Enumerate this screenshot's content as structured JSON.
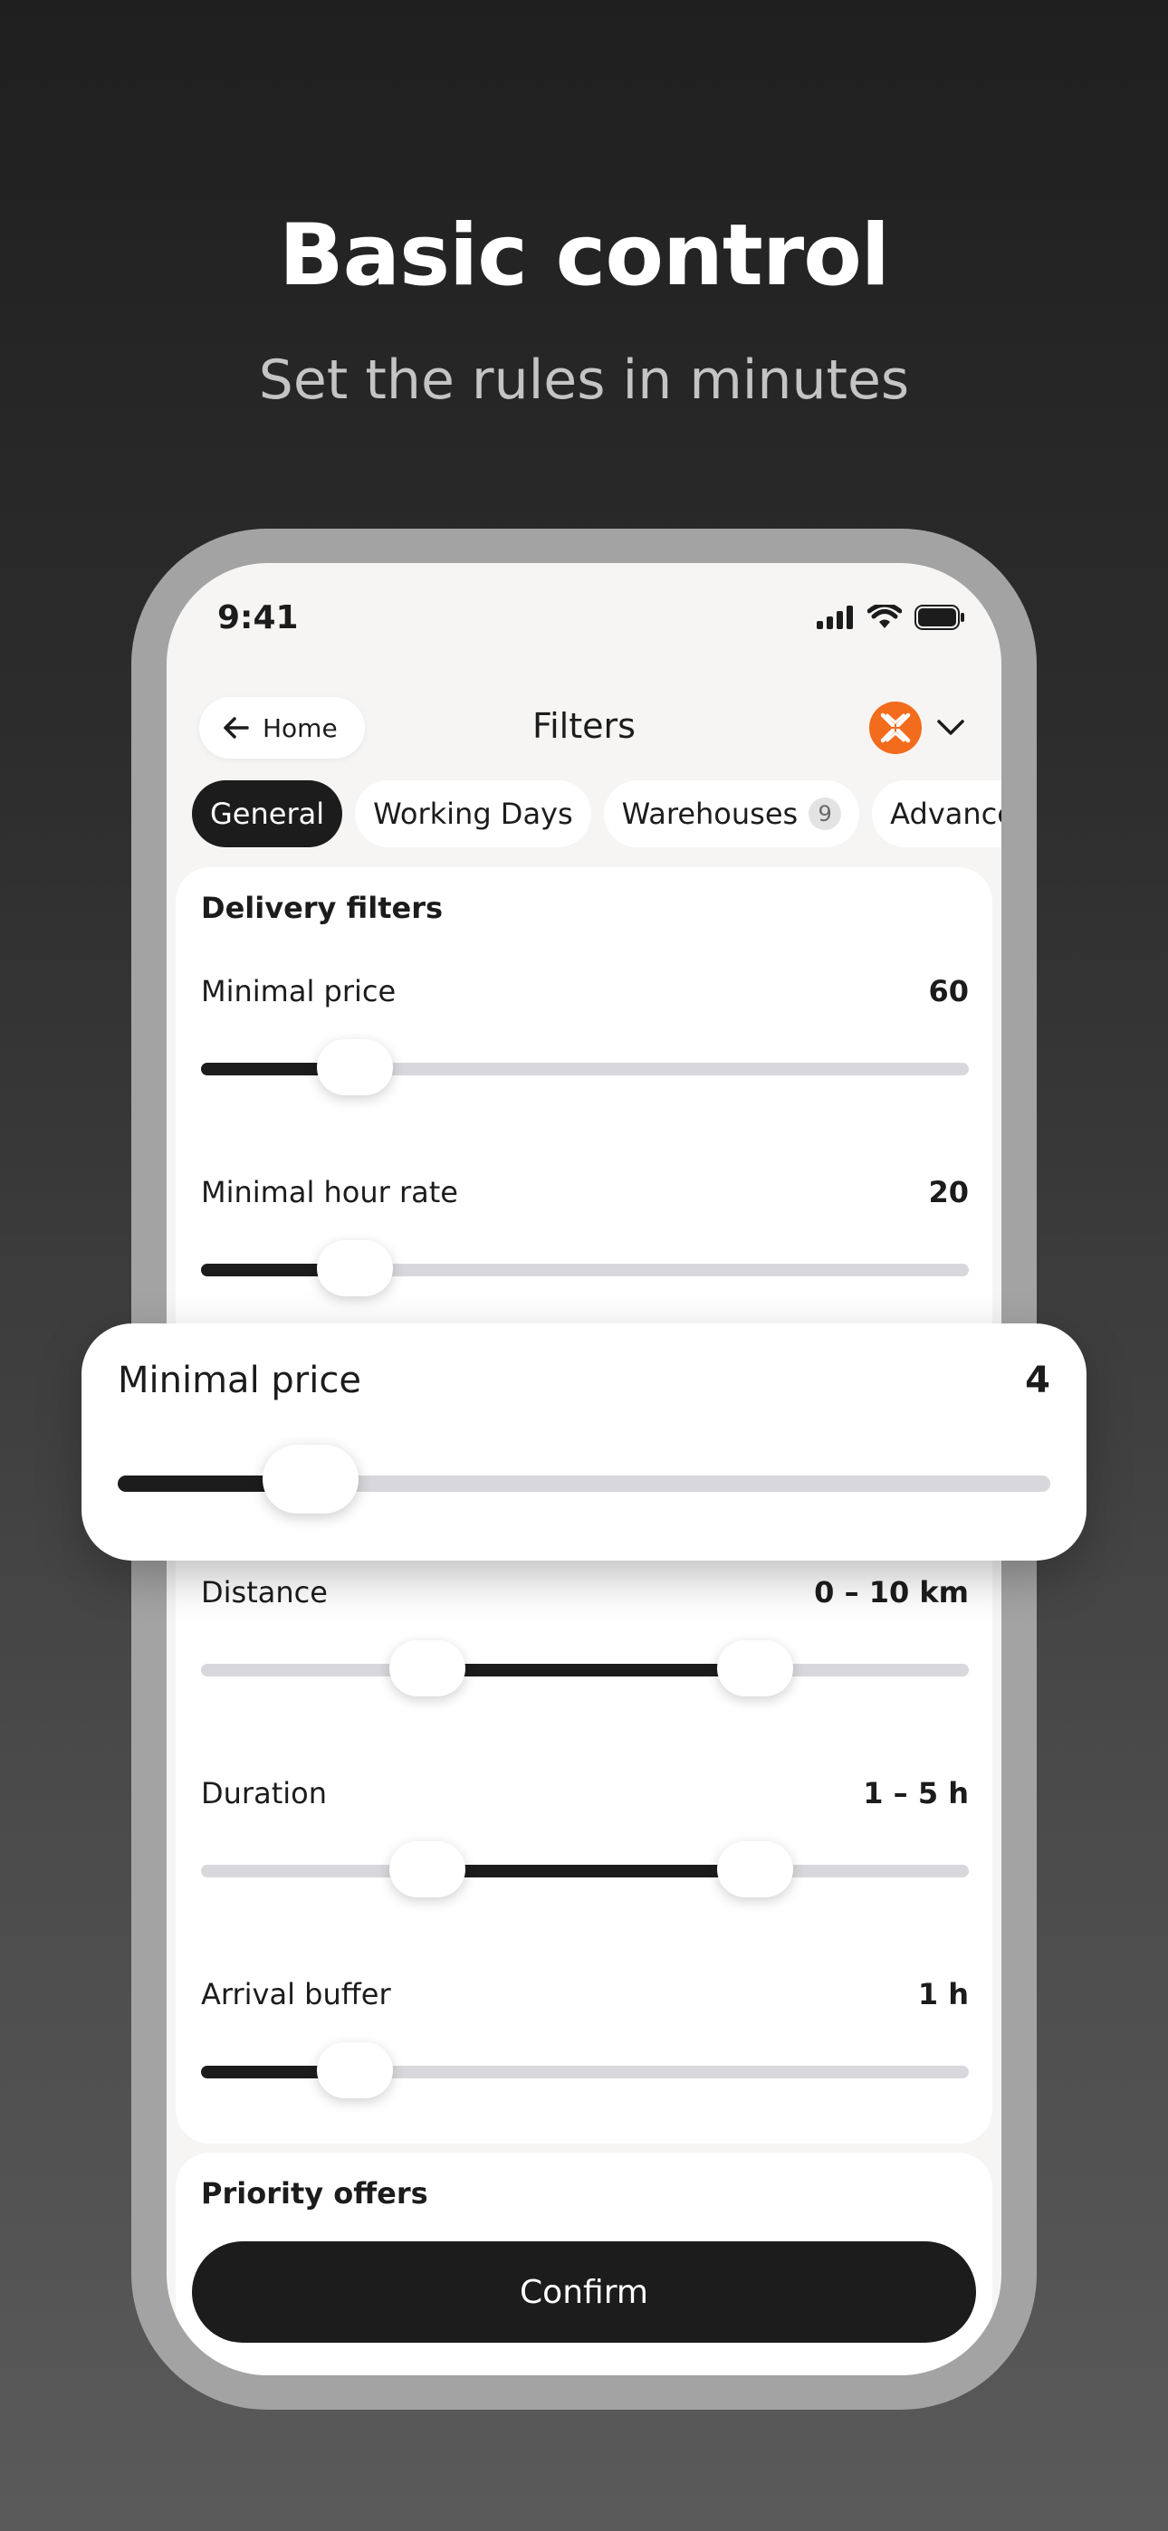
{
  "hero": {
    "title": "Basic control",
    "subtitle": "Set the rules in minutes"
  },
  "status_bar": {
    "time": "9:41",
    "icons": [
      "cellular-signal-icon",
      "wifi-icon",
      "battery-icon"
    ]
  },
  "header": {
    "back_label": "Home",
    "title": "Filters",
    "brand_icon": "brand-logo-icon",
    "dropdown_icon": "chevron-down-icon",
    "brand_color": "#f36b1c"
  },
  "tabs": [
    {
      "label": "General",
      "active": true
    },
    {
      "label": "Working Days",
      "active": false
    },
    {
      "label": "Warehouses",
      "badge": "9",
      "active": false
    },
    {
      "label": "Advanced",
      "active": false
    }
  ],
  "delivery_filters": {
    "title": "Delivery filters",
    "rows": [
      {
        "label": "Minimal price",
        "value": "60",
        "fill": 0.2
      },
      {
        "label": "Minimal hour rate",
        "value": "20",
        "fill": 0.2
      },
      {
        "label": "Distance",
        "value": "0 – 10 km",
        "range": [
          0.29,
          0.71
        ]
      },
      {
        "label": "Duration",
        "value": "1 – 5 h",
        "range": [
          0.29,
          0.71
        ]
      },
      {
        "label": "Arrival buffer",
        "value": "1 h",
        "fill": 0.2
      }
    ]
  },
  "priority_offers": {
    "title": "Priority offers"
  },
  "confirm_label": "Confirm",
  "popout": {
    "label": "Minimal price",
    "value": "4",
    "fill": 0.15
  }
}
